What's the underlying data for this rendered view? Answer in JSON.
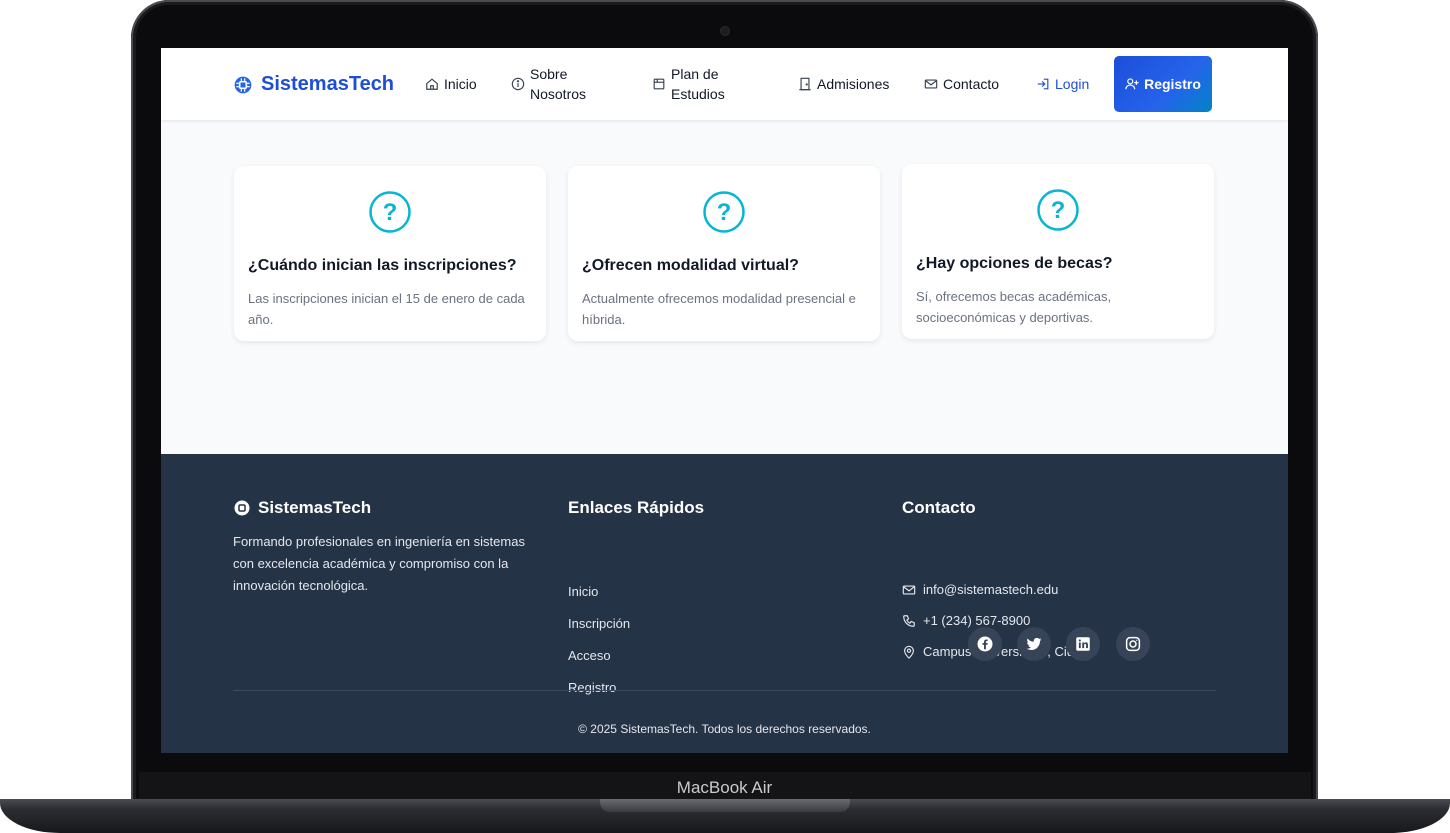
{
  "device": {
    "model_label": "MacBook Air"
  },
  "nav": {
    "brand": "SistemasTech",
    "items": [
      {
        "label": "Inicio",
        "icon": "home-icon"
      },
      {
        "label": "Sobre Nosotros",
        "icon": "info-icon"
      },
      {
        "label": "Plan de Estudios",
        "icon": "calendar-icon"
      },
      {
        "label": "Admisiones",
        "icon": "door-icon"
      },
      {
        "label": "Contacto",
        "icon": "envelope-icon"
      },
      {
        "label": "Login",
        "icon": "login-icon"
      }
    ],
    "register_button": "Registro",
    "accent": "#1d4ed8"
  },
  "faq": [
    {
      "icon": "question-circle-icon",
      "title": "¿Cuándo inician las inscripciones?",
      "answer": "Las inscripciones inician el 15 de enero de cada año."
    },
    {
      "icon": "question-circle-icon",
      "title": "¿Ofrecen modalidad virtual?",
      "answer": "Actualmente ofrecemos modalidad presencial e híbrida."
    },
    {
      "icon": "question-circle-icon",
      "title": "¿Hay opciones de becas?",
      "answer": "Sí, ofrecemos becas académicas, socioeconómicas y deportivas."
    }
  ],
  "footer": {
    "brand": "SistemasTech",
    "description": "Formando profesionales en ingeniería en sistemas con excelencia académica y compromiso con la innovación tecnológica.",
    "quick_links_title": "Enlaces Rápidos",
    "quick_links": [
      "Inicio",
      "Inscripción",
      "Acceso",
      "Registro"
    ],
    "contact_title": "Contacto",
    "contact": {
      "email": "info@sistemastech.edu",
      "phone": "+1 (234) 567-8900",
      "address": "Campus Universitario, Ciudad"
    },
    "social": [
      "facebook-icon",
      "twitter-icon",
      "linkedin-icon",
      "instagram-icon"
    ],
    "copyright": "© 2025 SistemasTech. Todos los derechos reservados.",
    "background": "#253347"
  },
  "colors": {
    "question_icon": "#06b6d4"
  }
}
